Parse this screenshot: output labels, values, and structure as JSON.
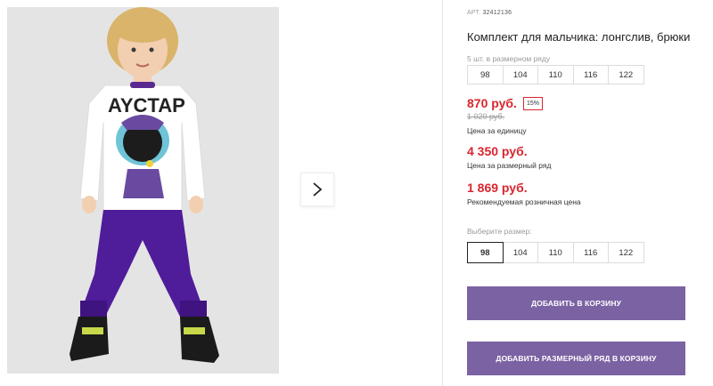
{
  "product": {
    "article_label": "АРТ.",
    "article_number": "32412136",
    "title": "Комплект для мальчика: лонгслив, брюки",
    "pack_note": "5 шт. в размерном ряду",
    "pack_sizes": [
      "98",
      "104",
      "110",
      "116",
      "122"
    ]
  },
  "pricing": {
    "unit_price": "870 руб.",
    "discount": "15%",
    "old_price": "1 020 руб.",
    "unit_caption": "Цена за единицу",
    "set_price": "4 350 руб.",
    "set_caption": "Цена за размерный ряд",
    "retail_price": "1 869 руб.",
    "retail_caption": "Рекомендуемая розничная цена",
    "accent_color": "#d8262f"
  },
  "size_picker": {
    "label": "Выберите размер:",
    "options": [
      "98",
      "104",
      "110",
      "116",
      "122"
    ],
    "selected": "98"
  },
  "actions": {
    "add_to_cart": "ДОБАВИТЬ В КОРЗИНУ",
    "add_set_to_cart": "ДОБАВИТЬ РАЗМЕРНЫЙ РЯД В КОРЗИНУ",
    "button_color": "#7b62a3"
  },
  "gallery": {
    "photo_icon": "product-photo",
    "next_icon": "chevron-right-icon"
  }
}
